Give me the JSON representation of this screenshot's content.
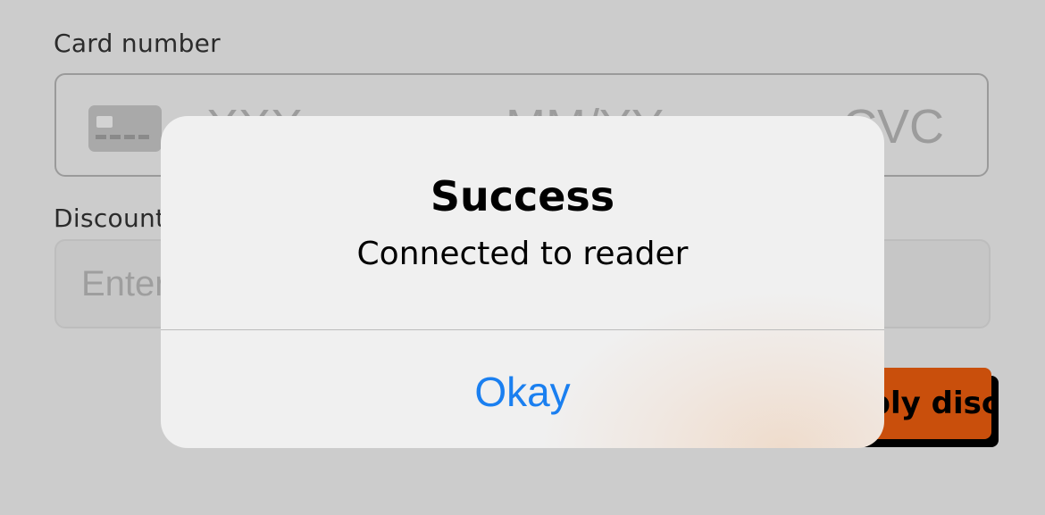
{
  "form": {
    "card_label": "Card number",
    "card_number_placeholder": "XXX",
    "expiry_placeholder": "MM/YY",
    "cvc_placeholder": "CVC",
    "discount_label": "Discount",
    "discount_placeholder": "Enter",
    "apply_button_label": "Apply discount"
  },
  "alert": {
    "title": "Success",
    "message": "Connected to reader",
    "button_label": "Okay"
  },
  "colors": {
    "background": "#cccccc",
    "accent_button": "#c94f0c",
    "alert_link": "#1a7ff0"
  },
  "icons": {
    "card": "credit-card-icon"
  }
}
